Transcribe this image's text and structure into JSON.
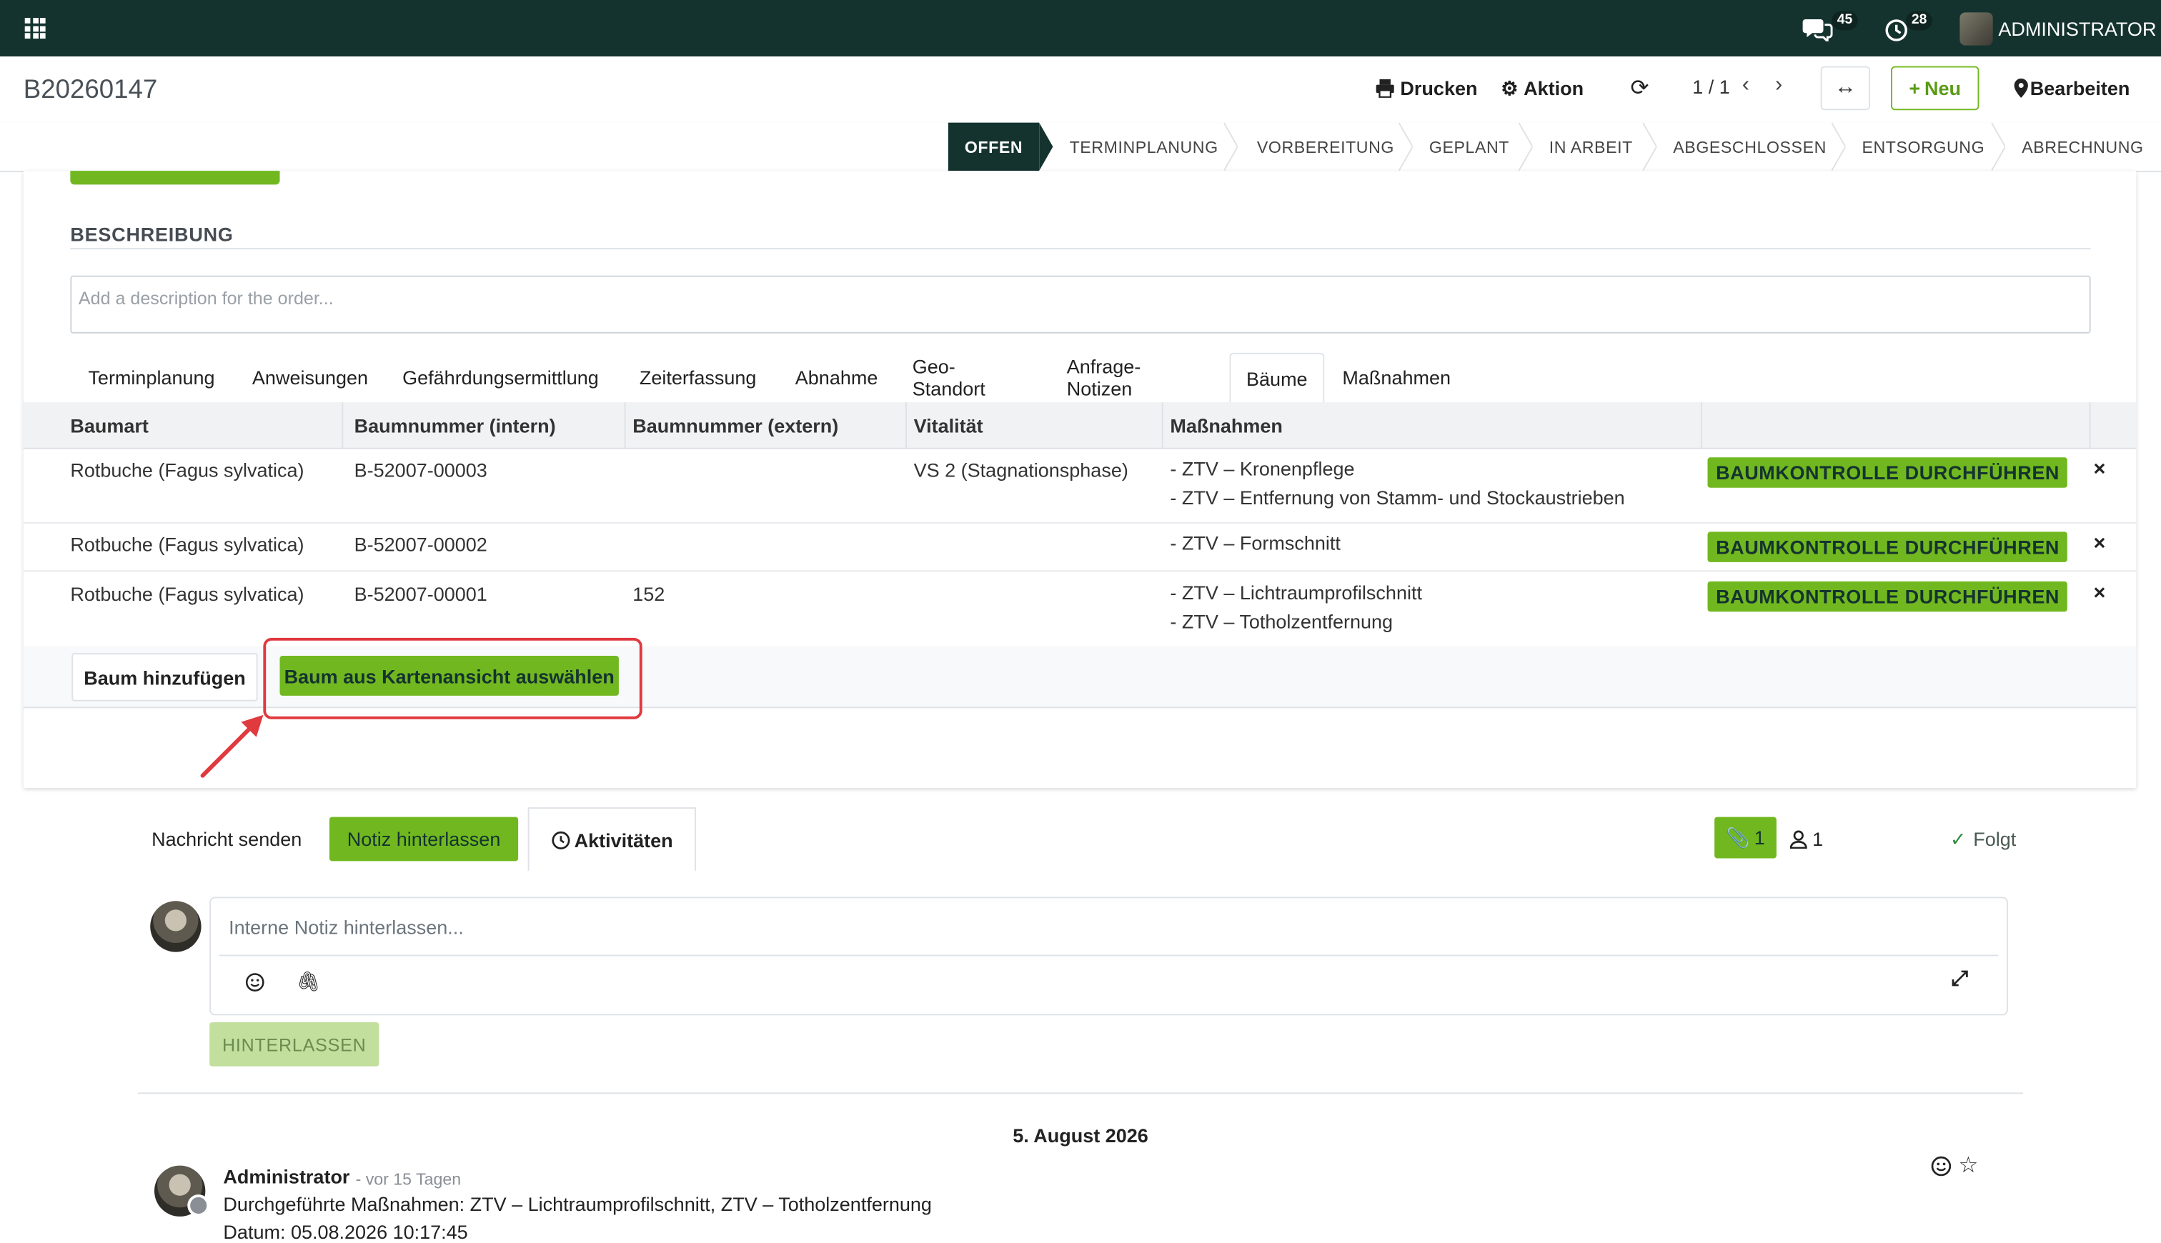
{
  "topbar": {
    "messages_count": "45",
    "activities_count": "28",
    "user_name": "ADMINISTRATOR"
  },
  "control_panel": {
    "record_name": "B20260147",
    "print_label": "Drucken",
    "action_label": "Aktion",
    "pager": "1 / 1",
    "new_label": "Neu",
    "edit_label": "Bearbeiten"
  },
  "status_stages": [
    {
      "label": "OFFEN",
      "active": true
    },
    {
      "label": "TERMINPLANUNG"
    },
    {
      "label": "VORBEREITUNG"
    },
    {
      "label": "GEPLANT"
    },
    {
      "label": "IN ARBEIT"
    },
    {
      "label": "ABGESCHLOSSEN"
    },
    {
      "label": "ENTSORGUNG"
    },
    {
      "label": "ABRECHNUNG"
    }
  ],
  "form": {
    "section_title": "BESCHREIBUNG",
    "description_placeholder": "Add a description for the order...",
    "tabs": [
      "Terminplanung",
      "Anweisungen",
      "Gefährdungsermittlung",
      "Zeiterfassung",
      "Abnahme",
      "Geo-Standort",
      "Anfrage-Notizen",
      "Bäume",
      "Maßnahmen"
    ],
    "active_tab": "Bäume",
    "columns": [
      "Baumart",
      "Baumnummer (intern)",
      "Baumnummer (extern)",
      "Vitalität",
      "Maßnahmen"
    ],
    "rows": [
      {
        "species": "Rotbuche (Fagus sylvatica)",
        "intern": "B-52007-00003",
        "extern": "",
        "vitality": "VS 2 (Stagnationsphase)",
        "measures": [
          "- ZTV – Kronenpflege",
          "- ZTV – Entfernung von Stamm- und Stockaustrieben"
        ],
        "action": "BAUMKONTROLLE DURCHFÜHREN"
      },
      {
        "species": "Rotbuche (Fagus sylvatica)",
        "intern": "B-52007-00002",
        "extern": "",
        "vitality": "",
        "measures": [
          "- ZTV – Formschnitt"
        ],
        "action": "BAUMKONTROLLE DURCHFÜHREN"
      },
      {
        "species": "Rotbuche (Fagus sylvatica)",
        "intern": "B-52007-00001",
        "extern": "152",
        "vitality": "",
        "measures": [
          "- ZTV – Lichtraumprofilschnitt",
          "- ZTV – Totholzentfernung"
        ],
        "action": "BAUMKONTROLLE DURCHFÜHREN"
      }
    ],
    "delete_glyph": "×",
    "add_tree_label": "Baum hinzufügen",
    "select_from_map_label": "Baum aus Kartenansicht auswählen"
  },
  "chatter": {
    "send_message_label": "Nachricht senden",
    "log_note_label": "Notiz hinterlassen",
    "activities_label": "Aktivitäten",
    "attachments_count": "1",
    "followers_count": "1",
    "follow_label": "Folgt",
    "composer_placeholder": "Interne Notiz hinterlassen...",
    "submit_label": "HINTERLASSEN",
    "date_separator": "5. August 2026",
    "message": {
      "author": "Administrator",
      "time": "- vor 15 Tagen",
      "body": "Durchgeführte Maßnahmen: ZTV – Lichtraumprofilschnitt, ZTV – Totholzentfernung",
      "body2": "Datum: 05.08.2026 10:17:45"
    }
  },
  "colors": {
    "navbar": "#14332f",
    "accent": "#71b820",
    "highlight": "#e0393e"
  }
}
